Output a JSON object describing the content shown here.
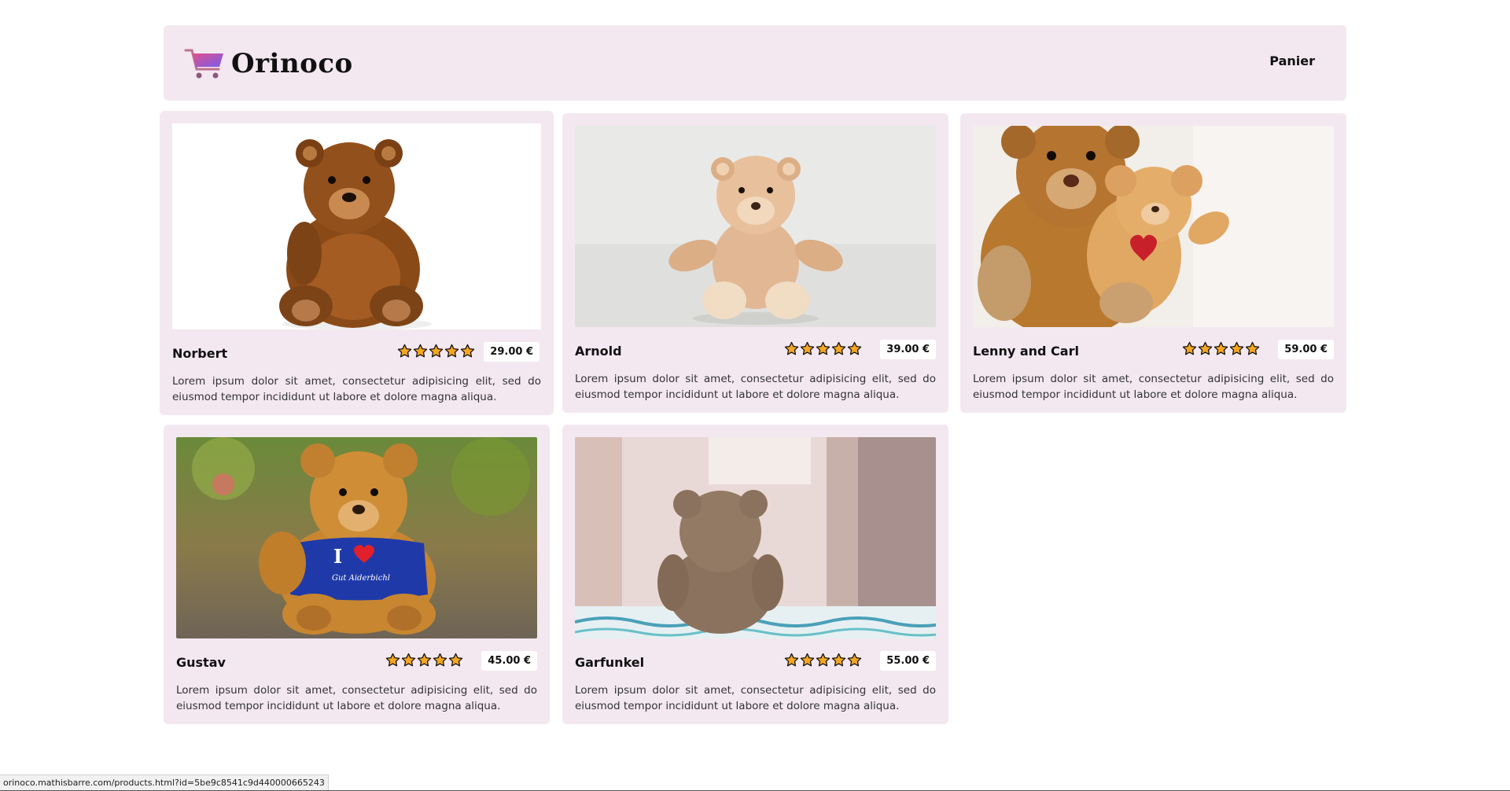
{
  "header": {
    "logo_text": "Orinoco",
    "logo_icon": "shopping-cart-icon",
    "cart_link": "Panier"
  },
  "products": [
    {
      "name": "Norbert",
      "price": "29.00 €",
      "rating": 5,
      "description": "Lorem ipsum dolor sit amet, consectetur adipisicing elit, sed do eiusmod tempor incididunt ut labore et dolore magna aliqua."
    },
    {
      "name": "Arnold",
      "price": "39.00 €",
      "rating": 5,
      "description": "Lorem ipsum dolor sit amet, consectetur adipisicing elit, sed do eiusmod tempor incididunt ut labore et dolore magna aliqua."
    },
    {
      "name": "Lenny and Carl",
      "price": "59.00 €",
      "rating": 5,
      "description": "Lorem ipsum dolor sit amet, consectetur adipisicing elit, sed do eiusmod tempor incididunt ut labore et dolore magna aliqua."
    },
    {
      "name": "Gustav",
      "price": "45.00 €",
      "rating": 5,
      "description": "Lorem ipsum dolor sit amet, consectetur adipisicing elit, sed do eiusmod tempor incididunt ut labore et dolore magna aliqua."
    },
    {
      "name": "Garfunkel",
      "price": "55.00 €",
      "rating": 5,
      "description": "Lorem ipsum dolor sit amet, consectetur adipisicing elit, sed do eiusmod tempor incididunt ut labore et dolore magna aliqua."
    }
  ],
  "status_bar": {
    "url": "orinoco.mathisbarre.com/products.html?id=5be9c8541c9d440000665243"
  },
  "colors": {
    "card_background": "#f3e8f0",
    "star_fill": "#f5a623",
    "logo_gradient_start": "#e0508a",
    "logo_gradient_end": "#7a5cf0"
  }
}
